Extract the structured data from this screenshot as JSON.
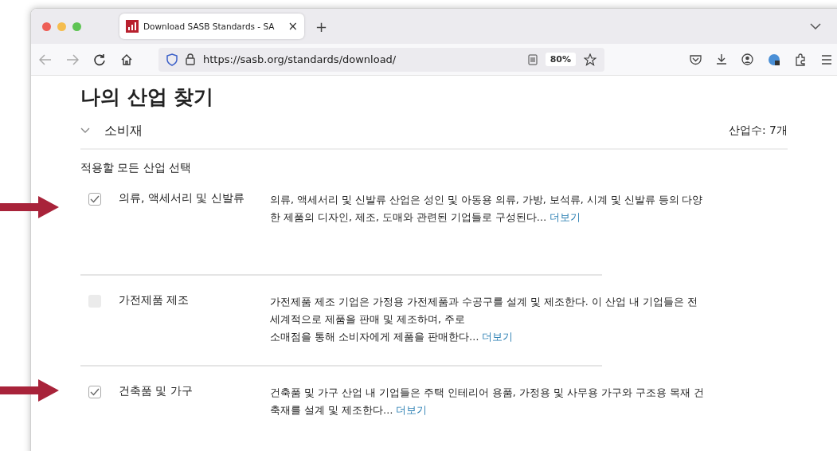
{
  "browser": {
    "tab_title": "Download SASB Standards - SA",
    "tab_close": "×",
    "new_tab": "+",
    "url": "https://sasb.org/standards/download/",
    "zoom": "80%"
  },
  "page": {
    "title": "나의 산업 찾기",
    "sector": {
      "name": "소비재",
      "expanded": true,
      "count": "산업수: 7개"
    },
    "select_all": "적용할 모든 산업 선택",
    "industries": [
      {
        "name": "의류, 액세서리 및 신발류",
        "checked": true,
        "arrow": true,
        "description": [
          "의류, 액세서리 및 신발류 산업은 성인 및 아동용 의류, 가방, 보석류, 시계 및 신발류 등의 다양",
          "한 제품의 디자인, 제조, 도매와 관련된 기업들로 구성된다…"
        ],
        "more": "더보기"
      },
      {
        "name": "가전제품 제조",
        "checked": false,
        "arrow": false,
        "description": [
          "가전제품 제조 기업은 가정용 가전제품과 수공구를 설계 및 제조한다. 이 산업 내 기업들은 전",
          "세계적으로 제품을 판매 및 제조하며, 주로",
          "소매점을 통해 소비자에게 제품을 판매한다…"
        ],
        "more": "더보기"
      },
      {
        "name": "건축품 및 가구",
        "checked": true,
        "arrow": true,
        "description": [
          "건축품 및 가구 산업 내 기업들은 주택 인테리어 용품, 가정용 및 사무용 가구와 구조용 목재 건",
          "축재를 설계 및 제조한다…"
        ],
        "more": "더보기"
      }
    ]
  }
}
